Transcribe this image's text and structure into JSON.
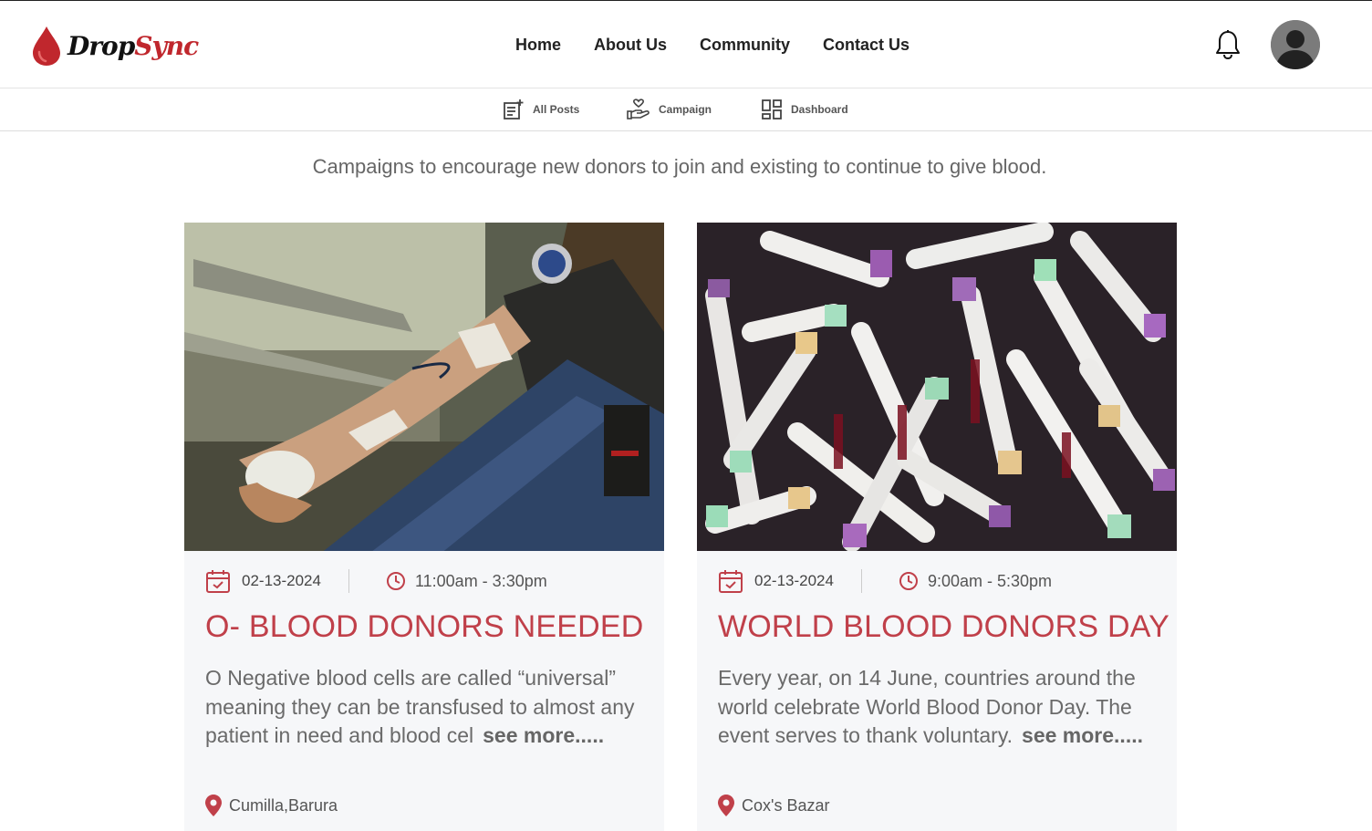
{
  "app": {
    "logo_part1": "Drop",
    "logo_part2": "Sync",
    "brand_color": "#c0272d"
  },
  "nav": {
    "items": [
      {
        "label": "Home"
      },
      {
        "label": "About Us"
      },
      {
        "label": "Community"
      },
      {
        "label": "Contact Us"
      }
    ],
    "icons": [
      "bell-icon",
      "avatar-icon"
    ]
  },
  "subnav": {
    "items": [
      {
        "label": "All Posts",
        "icon": "add-post-icon"
      },
      {
        "label": "Campaign",
        "icon": "hand-heart-icon"
      },
      {
        "label": "Dashboard",
        "icon": "dashboard-grid-icon"
      }
    ]
  },
  "tagline": "Campaigns to encourage new donors to join and existing to continue to give blood.",
  "campaigns": [
    {
      "date": "02-13-2024",
      "time": "11:00am - 3:30pm",
      "title": "O- BLOOD DONORS NEEDED",
      "description": "O Negative blood cells are called “universal” meaning they can be transfused to almost any patient in need and blood cel",
      "see_more": "see more.....",
      "location": "Cumilla,Barura"
    },
    {
      "date": "02-13-2024",
      "time": "9:00am - 5:30pm",
      "title": "WORLD BLOOD DONORS DAY",
      "description": "Every year, on 14 June, countries around the world celebrate World Blood Donor Day. The event serves to thank voluntary.",
      "see_more": "see more.....",
      "location": "Cox's Bazar"
    }
  ],
  "accent_color": "#c0404a"
}
